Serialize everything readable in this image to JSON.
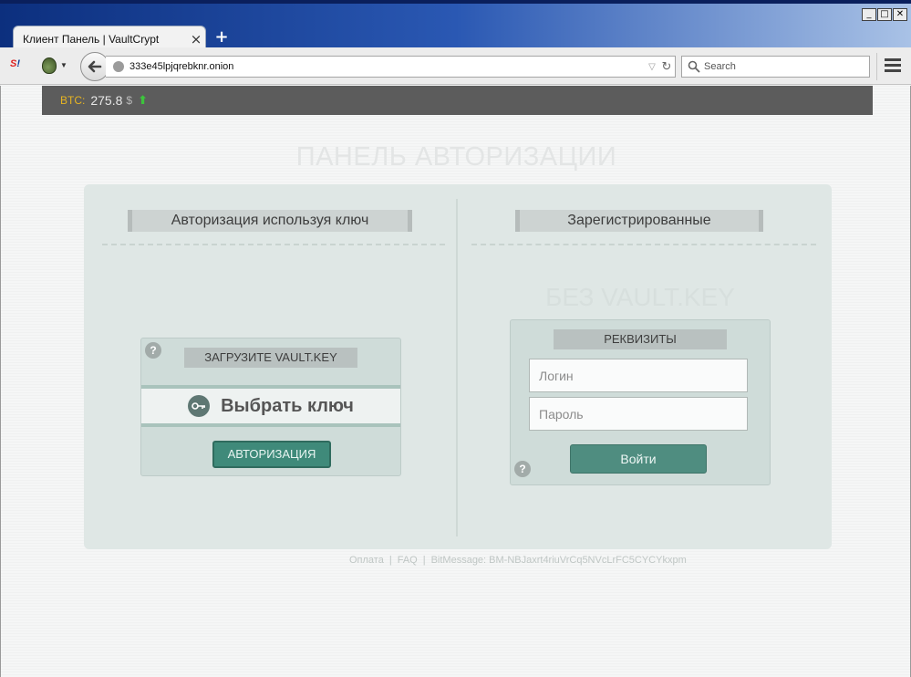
{
  "browser": {
    "tab_title": "Клиент Панель | VaultCrypt",
    "tab_close": "×",
    "new_tab": "+",
    "url": "333e45lpjqrebknr.onion",
    "search_placeholder": "Search",
    "window_controls": [
      "_",
      "□",
      "✕"
    ],
    "addon_icon_text": "S"
  },
  "btc": {
    "label": "BTC:",
    "value": "275.8",
    "currency": "$",
    "trend_icon": "up-arrow-icon",
    "trend_glyph": "⬆",
    "trend_color": "#3cc43c"
  },
  "page": {
    "title": "ПАНЕЛЬ АВТОРИЗАЦИИ"
  },
  "left_section": {
    "heading": "Авторизация используя ключ",
    "help": "?",
    "upload_label": "ЗАГРУЗИТЕ VAULT.KEY",
    "choose_key_label": "Выбрать ключ",
    "auth_button": "АВТОРИЗАЦИЯ"
  },
  "right_section": {
    "heading": "Зарегистрированные",
    "subtitle": "БЕЗ VAULT.KEY",
    "credentials_label": "РЕКВИЗИТЫ",
    "login_placeholder": "Логин",
    "password_placeholder": "Пароль",
    "login_button": "Войти",
    "help": "?"
  },
  "footer": {
    "links": [
      "Оплата",
      "FAQ",
      "BitMessage: BM-NBJaxrt4riuVrCq5NVcLrFC5CYCYkxpm"
    ],
    "separator": "|"
  },
  "colors": {
    "accent": "#3f8a7a",
    "btc_label": "#e6b422",
    "btc_bar": "#5c5c5c",
    "panel": "#dfe7e5"
  }
}
